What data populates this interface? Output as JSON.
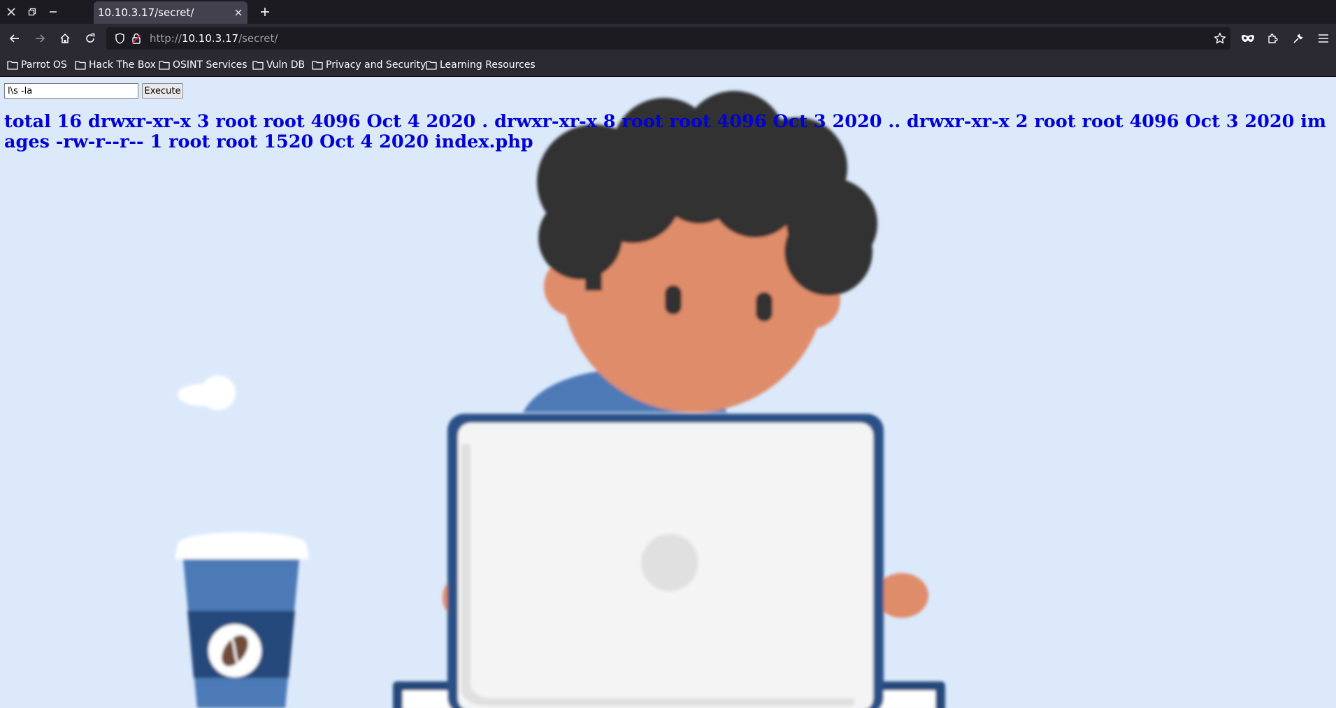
{
  "window": {
    "close_icon": "close-icon",
    "restore_icon": "restore-icon",
    "minimize_icon": "minimize-icon"
  },
  "tabs": [
    {
      "title": "10.10.3.17/secret/",
      "active": true
    }
  ],
  "navbar": {
    "url_prefix": "http://",
    "url_host": "10.10.3.17",
    "url_path": "/secret/"
  },
  "bookmarks": [
    {
      "label": "Parrot OS"
    },
    {
      "label": "Hack The Box"
    },
    {
      "label": "OSINT Services"
    },
    {
      "label": "Vuln DB"
    },
    {
      "label": "Privacy and Security"
    },
    {
      "label": "Learning Resources"
    }
  ],
  "page": {
    "command_value": "l\\s -la",
    "execute_label": "Execute",
    "output_text": "total 16 drwxr-xr-x 3 root root 4096 Oct 4 2020 . drwxr-xr-x 8 root root 4096 Oct 3 2020 .. drwxr-xr-x 2 root root 4096 Oct 3 2020 images -rw-r--r-- 1 root root 1520 Oct 4 2020 index.php"
  },
  "colors": {
    "page_background": "#dbe9fb",
    "output_text": "#0000d6",
    "chrome_dark": "#1c1b22",
    "chrome_toolbar": "#2b2a33"
  }
}
